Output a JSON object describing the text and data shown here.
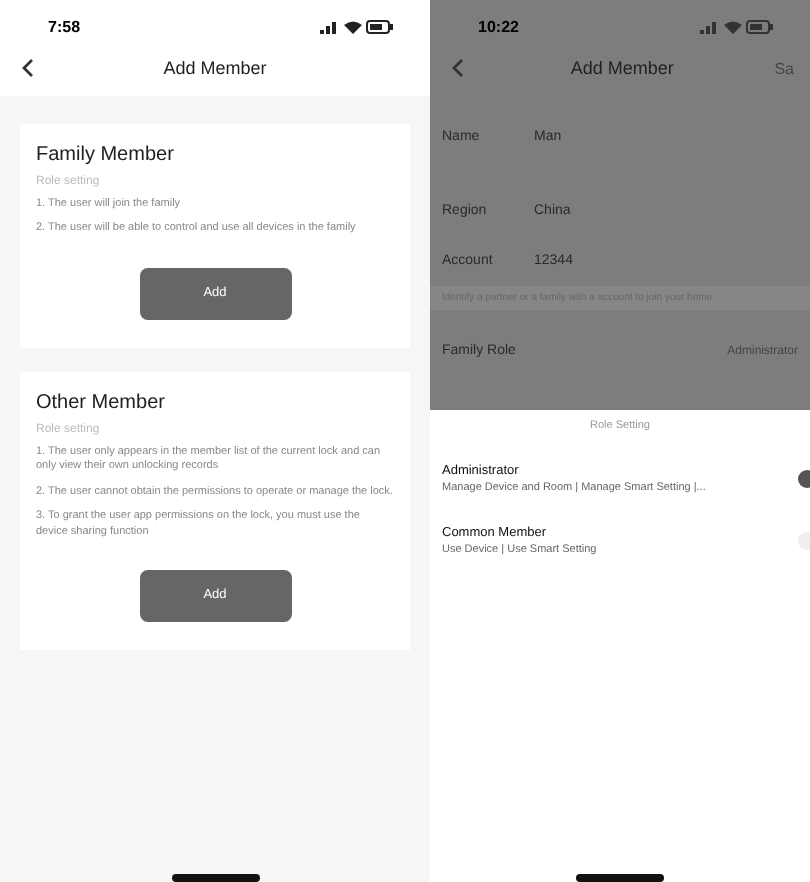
{
  "left_screen": {
    "status_bar": {
      "time": "7:58"
    },
    "title": "Add Member",
    "cards": [
      {
        "title": "Family Member",
        "subtitle": "Role setting",
        "lines": [
          "1. The user will join the family",
          "2. The user will be able to control and use all devices in the family"
        ],
        "button": "Add"
      },
      {
        "title": "Other Member",
        "subtitle": "Role setting",
        "lines": [
          "1. The user only appears in the member list of the current lock and can only view their own unlocking records",
          "2. The user cannot obtain the permissions to operate or manage the lock.",
          "3. To grant the user app permissions on the lock, you must use the device sharing function"
        ],
        "button": "Add"
      }
    ]
  },
  "right_screen": {
    "status_bar": {
      "time": "10:22"
    },
    "title": "Add Member",
    "action": "Sa",
    "fields": [
      {
        "label": "Name",
        "value": "Man"
      },
      {
        "label": "Region",
        "value": "China"
      },
      {
        "label": "Account",
        "value": "12344"
      }
    ],
    "hint": "Identify a partner or a family with a account to join your home",
    "role": {
      "label": "Family Role",
      "value": "Administrator"
    },
    "sheet": {
      "title": "Role Setting",
      "options": [
        {
          "name": "Administrator",
          "description": "Manage Device and Room | Manage Smart Setting |...",
          "selected": true
        },
        {
          "name": "Common Member",
          "description": "Use Device | Use Smart Setting",
          "selected": false
        }
      ]
    }
  }
}
